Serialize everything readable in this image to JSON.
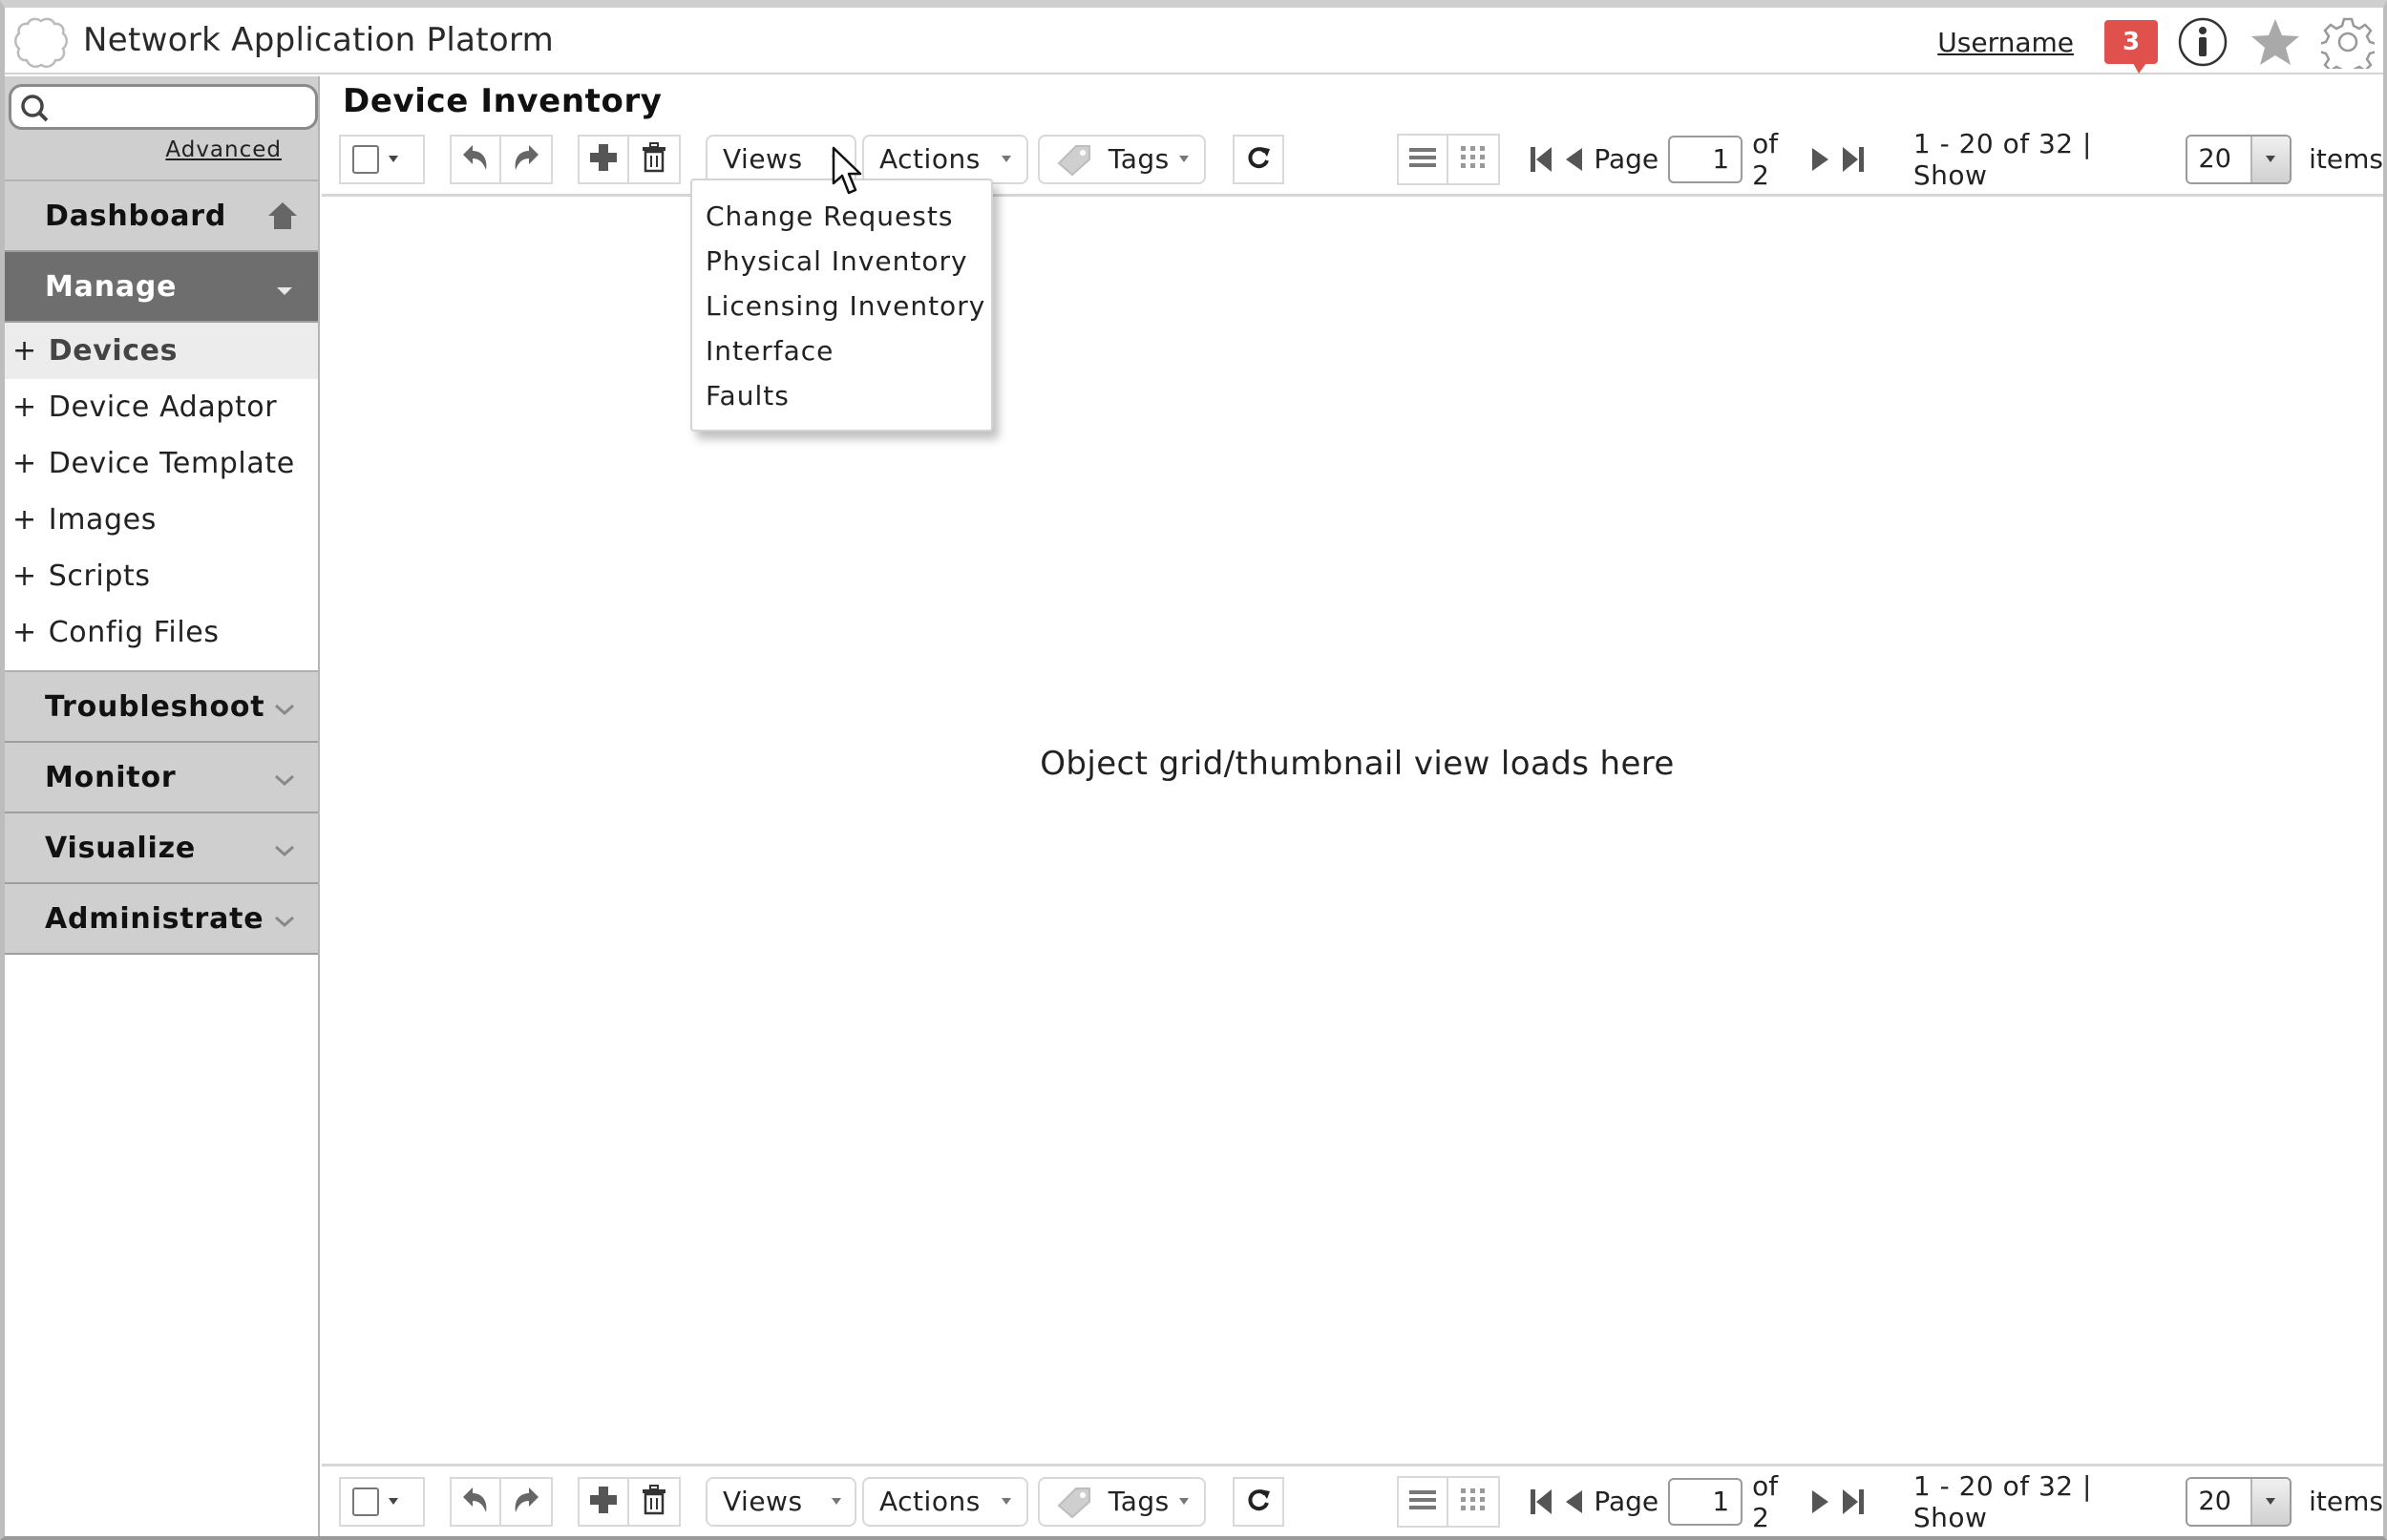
{
  "header": {
    "app_title": "Network Application Platorm",
    "username": "Username",
    "notification_count": "3",
    "icons": [
      "logo-icon",
      "info-icon",
      "star-icon",
      "gear-icon"
    ]
  },
  "sidebar": {
    "search": {
      "placeholder": "",
      "value": ""
    },
    "advanced_label": "Advanced",
    "sections": [
      {
        "label": "Dashboard",
        "icon": "home-icon"
      },
      {
        "label": "Manage",
        "icon": "chevron-down-icon",
        "active": true
      },
      {
        "label": "Troubleshoot",
        "icon": "chevron-down-icon"
      },
      {
        "label": "Monitor",
        "icon": "chevron-down-icon"
      },
      {
        "label": "Visualize",
        "icon": "chevron-down-icon"
      },
      {
        "label": "Administrate",
        "icon": "chevron-down-icon"
      }
    ],
    "manage_items": [
      {
        "label": "Devices",
        "prefix": "+",
        "selected": true
      },
      {
        "label": "Device Adaptor",
        "prefix": "+"
      },
      {
        "label": "Device Template",
        "prefix": "+"
      },
      {
        "label": "Images",
        "prefix": "+"
      },
      {
        "label": "Scripts",
        "prefix": "+"
      },
      {
        "label": "Config Files",
        "prefix": "+"
      }
    ]
  },
  "main": {
    "page_title": "Device Inventory",
    "placeholder": "Object grid/thumbnail view loads here",
    "toolbar": {
      "views_label": "Views",
      "actions_label": "Actions",
      "tags_label": "Tags",
      "page_label": "Page",
      "page_value": "1",
      "of_label": "of 2",
      "range_label": "1 - 20 of 32 | Show",
      "show_value": "20",
      "items_label": "items"
    },
    "views_menu": {
      "open": true,
      "items": [
        "Change Requests",
        "Physical Inventory",
        "Licensing Inventory",
        "Interface",
        "Faults"
      ]
    }
  },
  "colors": {
    "notification_badge": "#e0504d",
    "active_section_bg": "#6e6e6e",
    "section_bg": "#cfcfcf"
  }
}
